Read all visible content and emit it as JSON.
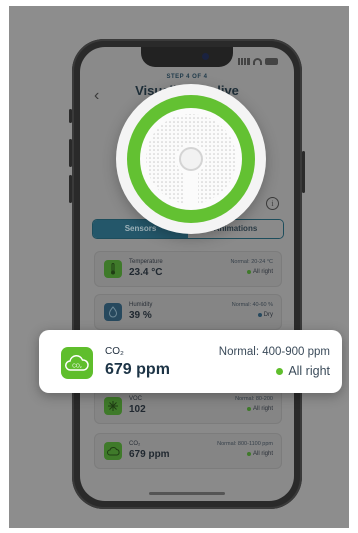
{
  "screen": {
    "step": "STEP 4 OF 4",
    "title": "Visualize the live"
  },
  "tabs": [
    {
      "label": "Sensors",
      "active": true
    },
    {
      "label": "Animations",
      "active": false
    }
  ],
  "cards": [
    {
      "name": "Temperature",
      "value": "23.4 °C",
      "normal": "Normal: 20-24 °C",
      "status": "All right",
      "status_color": "#3f7a2a",
      "icon": "thermometer-icon"
    },
    {
      "name": "Humidity",
      "value": "39 %",
      "normal": "Normal: 40-60 %",
      "status": "Dry",
      "status_color": "#27495e",
      "icon": "humidity-icon"
    },
    {
      "name": "VOC",
      "value": "102",
      "normal": "Normal: 80-200",
      "status": "All right",
      "status_color": "#3f7a2a",
      "icon": "voc-icon"
    },
    {
      "name": "CO₂",
      "value": "679 ppm",
      "normal": "Normal: 800-1100 ppm",
      "status": "All right",
      "status_color": "#3f7a2a",
      "icon": "co2-cloud-icon"
    }
  ],
  "highlight": {
    "name": "CO₂",
    "value": "679 ppm",
    "normal": "Normal:  400-900 ppm",
    "status": "All right",
    "icon_label": "CO₂",
    "accent": "#5fbe2c"
  },
  "colors": {
    "overlay": "#8d8d8d",
    "sensor_green": "#63c132",
    "tab_active": "#24576a"
  }
}
